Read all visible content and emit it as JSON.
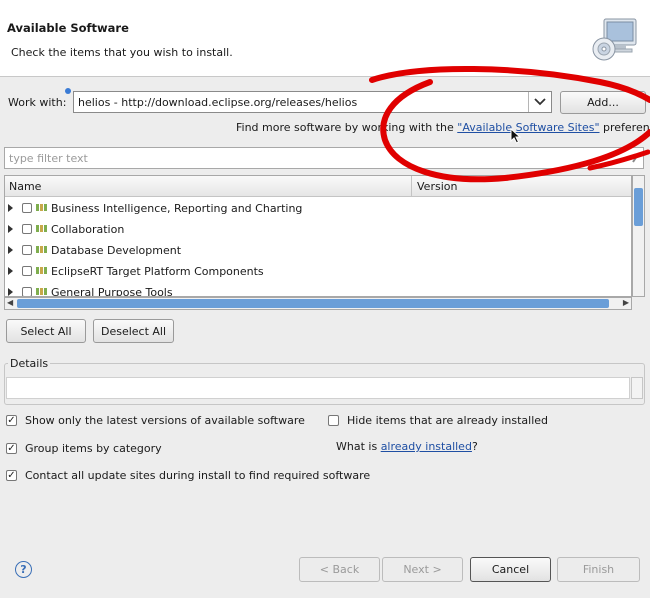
{
  "header": {
    "title": "Available Software",
    "description": "Check the items that you wish to install."
  },
  "work_with": {
    "label": "Work with:",
    "value": "helios - http://download.eclipse.org/releases/helios",
    "add_label": "Add..."
  },
  "find_more": {
    "prefix": "Find more software by working with the ",
    "link": "\"Available Software Sites\"",
    "suffix": " preferences."
  },
  "filter": {
    "placeholder": "type filter text"
  },
  "tree": {
    "columns": [
      "Name",
      "Version"
    ],
    "items": [
      "Business Intelligence, Reporting and Charting",
      "Collaboration",
      "Database Development",
      "EclipseRT Target Platform Components",
      "General Purpose Tools"
    ]
  },
  "buttons": {
    "select_all": "Select All",
    "deselect_all": "Deselect All"
  },
  "details": {
    "label": "Details"
  },
  "options": {
    "show_latest": "Show only the latest versions of available software",
    "hide_installed": "Hide items that are already installed",
    "group_by_category": "Group items by category",
    "what_is_prefix": "What is ",
    "what_is_link": "already installed",
    "what_is_suffix": "?",
    "contact_sites": "Contact all update sites during install to find required software",
    "checked": {
      "show_latest": true,
      "hide_installed": false,
      "group_by_category": true,
      "contact_sites": true
    }
  },
  "footer": {
    "help": "?",
    "back": "< Back",
    "next": "Next >",
    "cancel": "Cancel",
    "finish": "Finish"
  },
  "colors": {
    "link": "#1f4fa3",
    "scroll_thumb": "#6a9ed8",
    "annotation": "#e00000"
  }
}
